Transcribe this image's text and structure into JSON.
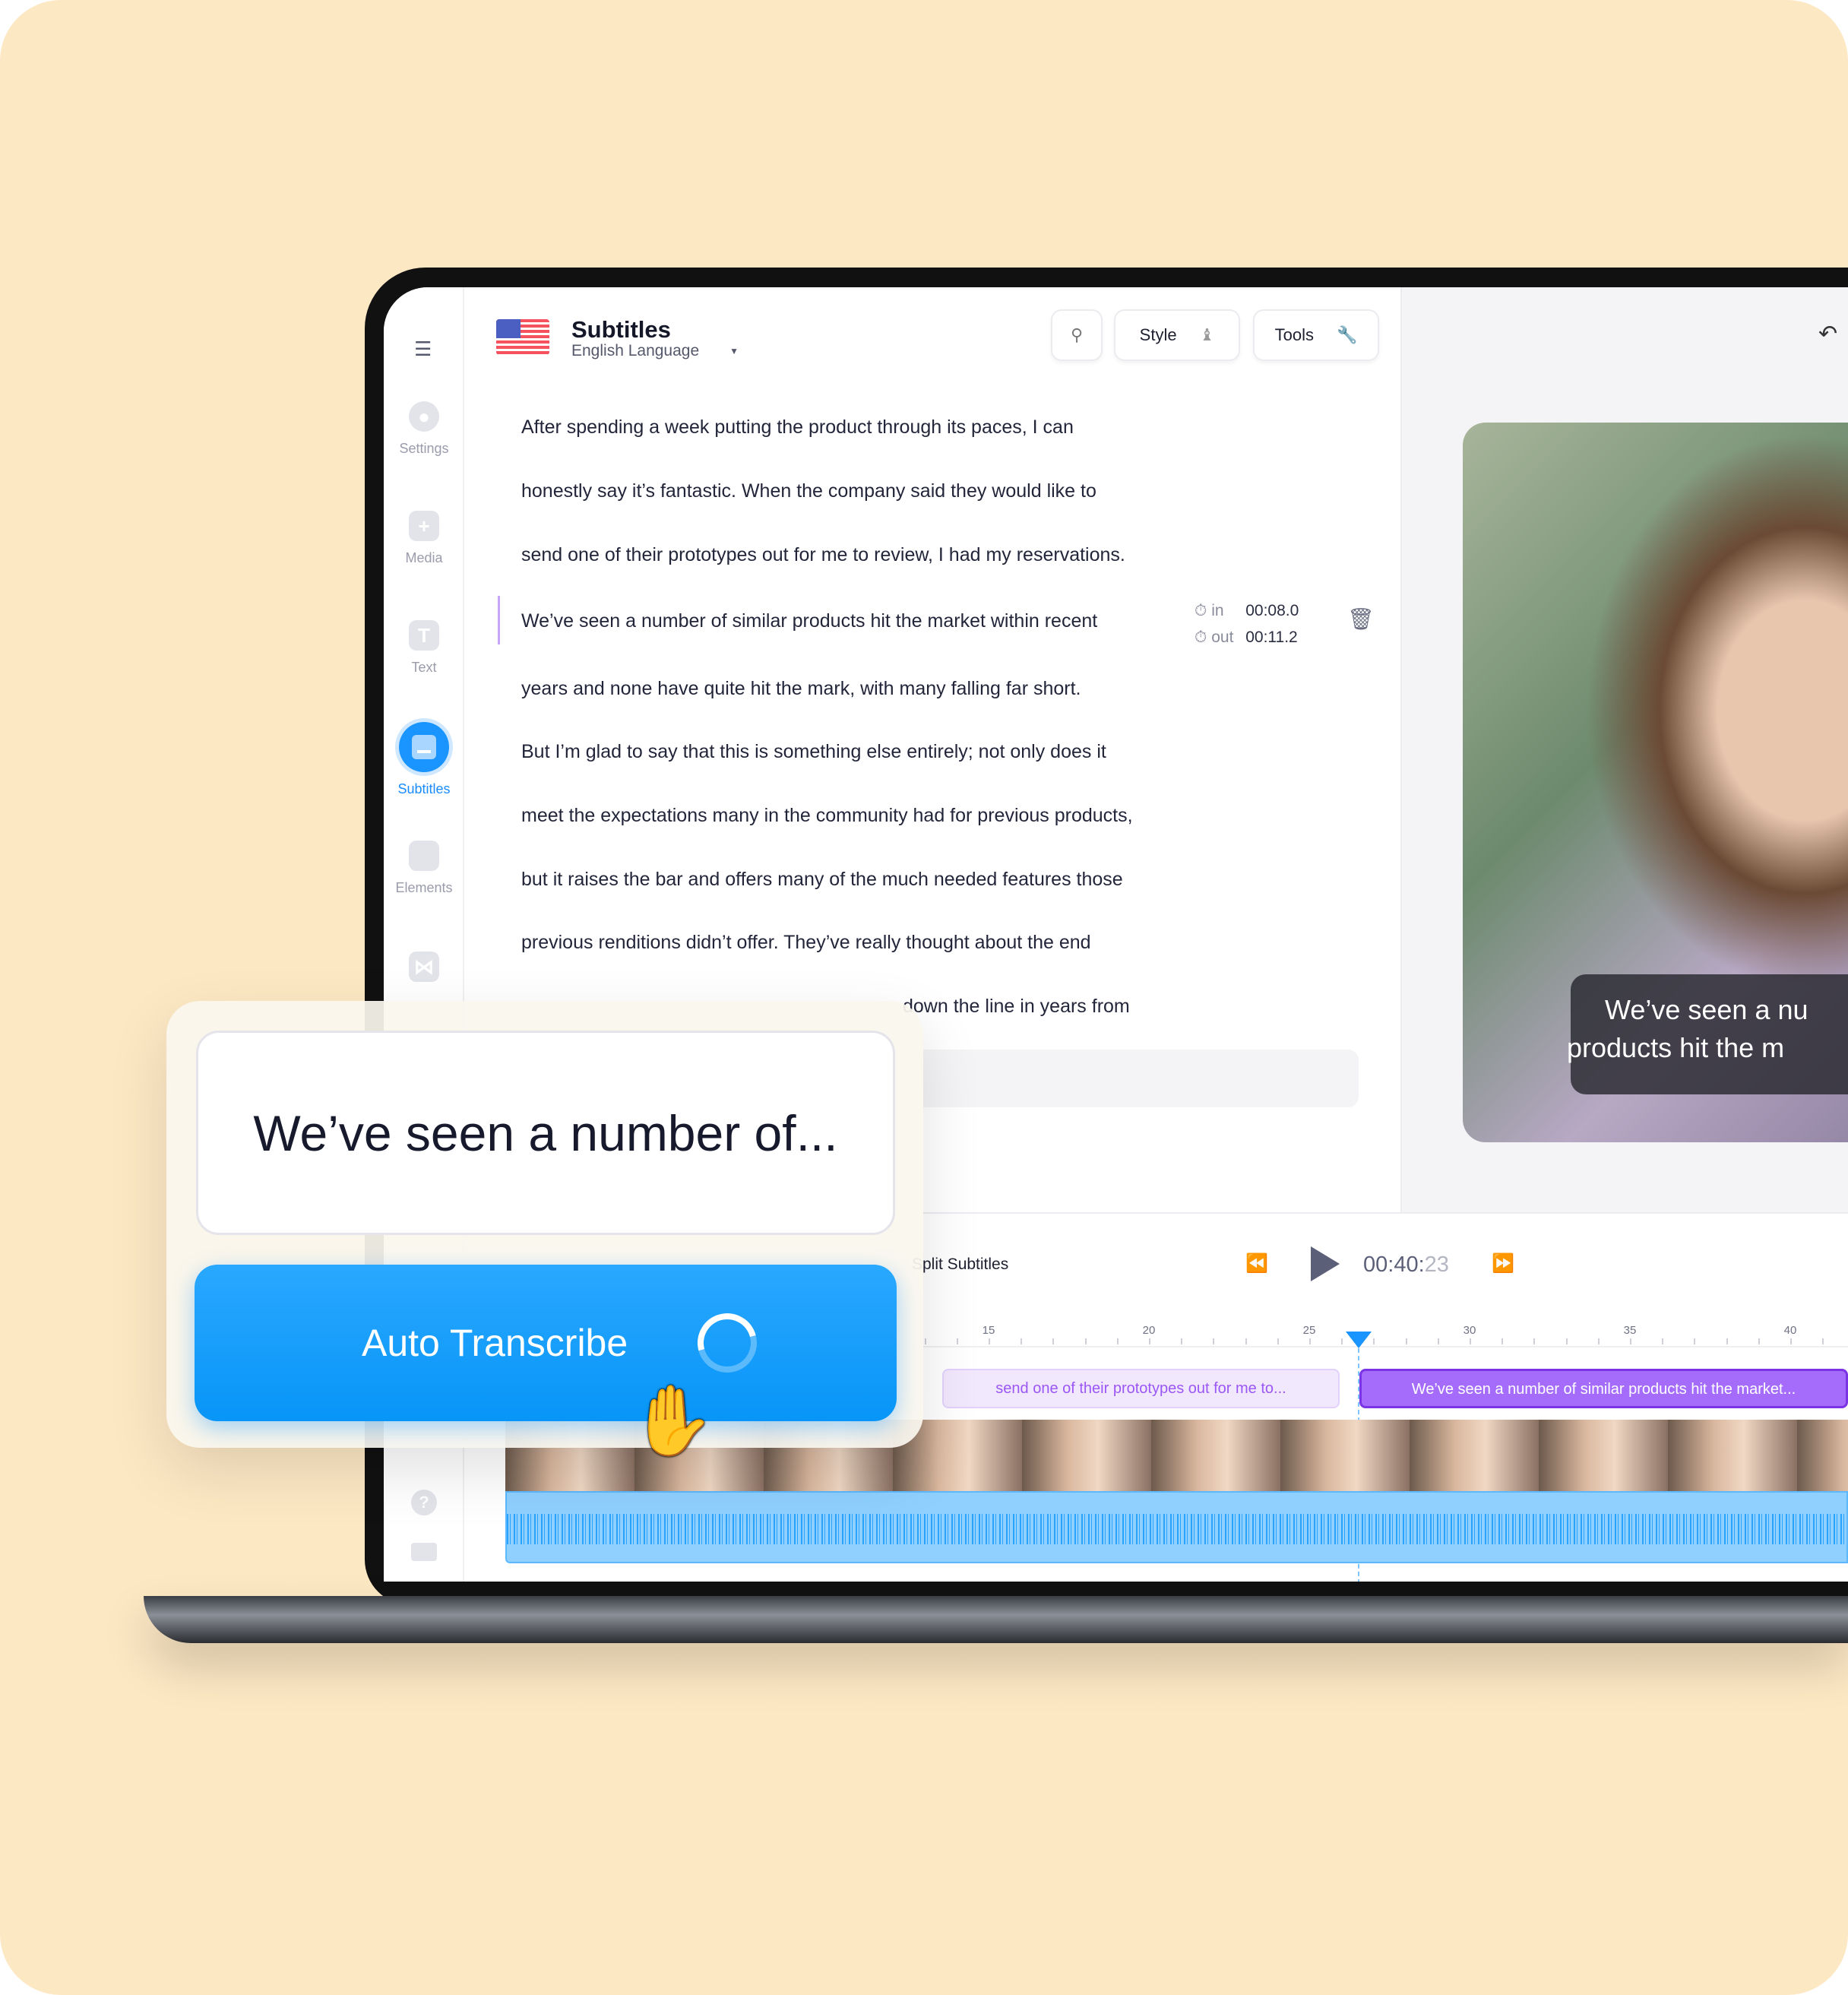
{
  "sidebar": {
    "items": [
      {
        "label": "Settings",
        "icon": "settings-icon"
      },
      {
        "label": "Media",
        "icon": "plus-icon"
      },
      {
        "label": "Text",
        "icon": "text-icon"
      },
      {
        "label": "Subtitles",
        "icon": "subtitles-icon",
        "active": true
      },
      {
        "label": "Elements",
        "icon": "elements-icon"
      }
    ]
  },
  "header": {
    "title": "Subtitles",
    "language": "English Language",
    "style_label": "Style",
    "tools_label": "Tools"
  },
  "transcript": {
    "lines": [
      "After spending a week putting the product through its paces, I can",
      "honestly say it’s fantastic. When the company said they would like to",
      "send one of their prototypes out for me to review, I had my reservations.",
      "We’ve seen a number of similar products hit the market within recent",
      "years and none have quite hit the mark, with many falling far short.",
      "But I’m glad to say that this is something else entirely; not only does it",
      "meet the expectations many in the community had for previous products,",
      "but it raises the bar and offers many of the much needed features those",
      "previous renditions didn’t offer. They’ve really thought about the end",
      "down the line in years from"
    ],
    "selected": {
      "in_label": "in",
      "in_time": "00:08.0",
      "out_label": "out",
      "out_time": "00:11.2"
    }
  },
  "preview": {
    "caption_line1": "We’ve seen a nu",
    "caption_line2": "products hit the m"
  },
  "player": {
    "split_label": "Split Subtitles",
    "time_main": "00:40:",
    "time_frames": "23"
  },
  "timeline": {
    "ticks": [
      "15",
      "20",
      "25",
      "30",
      "35",
      "40"
    ],
    "clips": [
      {
        "text": "send one of their prototypes out for me to..."
      },
      {
        "text": "We’ve seen a number of similar products hit the market..."
      }
    ]
  },
  "card": {
    "preview_text": "We’ve seen a number of...",
    "button_label": "Auto Transcribe"
  },
  "colors": {
    "accent": "#1a95ff",
    "clip_active": "#a56cfb",
    "clip_inactive": "#f1e8fd",
    "background": "#fde8c4"
  }
}
